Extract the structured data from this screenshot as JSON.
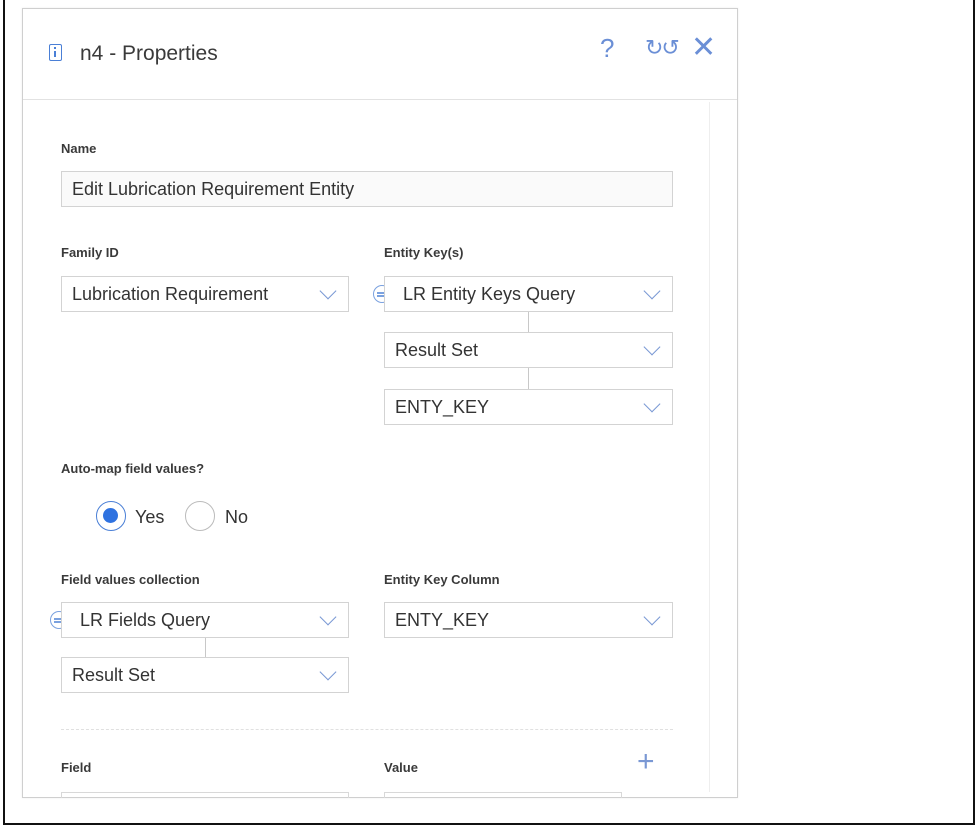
{
  "dialog": {
    "title": "n4 - Properties",
    "header_icon": "info-document-icon",
    "buttons": {
      "help": "?",
      "refresh": "↻↺",
      "close": "✕"
    }
  },
  "name_section": {
    "label": "Name",
    "value": "Edit Lubrication Requirement Entity"
  },
  "family_id": {
    "label": "Family ID",
    "value": "Lubrication Requirement"
  },
  "entity_keys": {
    "label": "Entity Key(s)",
    "query": "LR Entity Keys Query",
    "result": "Result Set",
    "column": "ENTY_KEY"
  },
  "auto_map": {
    "label": "Auto-map field values?",
    "options": [
      "Yes",
      "No"
    ],
    "selected": "Yes"
  },
  "field_values_collection": {
    "label": "Field values collection",
    "query": "LR Fields Query",
    "result": "Result Set"
  },
  "entity_key_column": {
    "label": "Entity Key Column",
    "value": "ENTY_KEY"
  },
  "mapping_table": {
    "field_header": "Field",
    "value_header": "Value",
    "add_icon": "plus-icon"
  },
  "colors": {
    "accent": "#2f72e0",
    "icon": "#7a98d4",
    "border": "#d3d3d3"
  }
}
